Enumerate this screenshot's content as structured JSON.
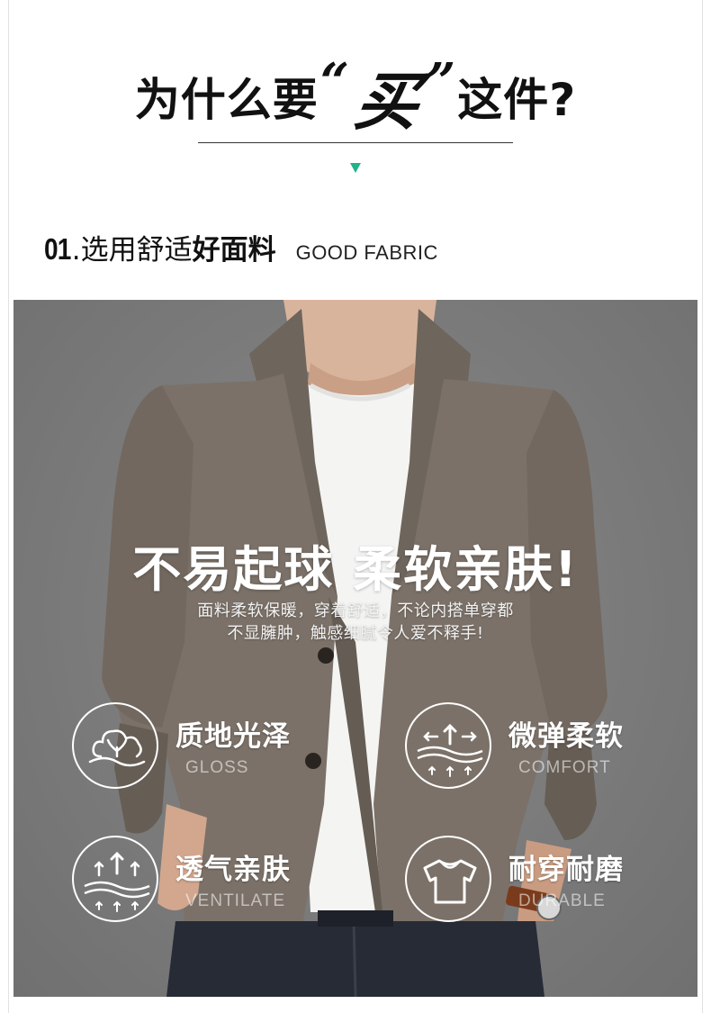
{
  "header": {
    "title_prefix": "为什么要",
    "open_quote": "“",
    "accent_word": "买",
    "close_quote": "”",
    "title_suffix": "这件?"
  },
  "section": {
    "number": "01",
    "title_light": ".选用舒适",
    "title_bold": "好面料",
    "title_en": "GOOD FABRIC"
  },
  "hero": {
    "headline": "不易起球  柔软亲肤!",
    "description_line1": "面料柔软保暖，穿着舒适，不论内搭单穿都",
    "description_line2": "不显臃肿，触感细腻令人爱不释手!"
  },
  "features": [
    {
      "label": "质地光泽",
      "en": "GLOSS",
      "icon": "cloud-sprout-icon"
    },
    {
      "label": "微弹柔软",
      "en": "COMFORT",
      "icon": "stretch-arrows-icon"
    },
    {
      "label": "透气亲肤",
      "en": "VENTILATE",
      "icon": "breathable-arrows-icon"
    },
    {
      "label": "耐穿耐磨",
      "en": "DURABLE",
      "icon": "tshirt-icon"
    }
  ],
  "colors": {
    "accent_arrow": "#1fb389",
    "background": "#ffffff",
    "photo_bg": "#7c7c7c",
    "jacket": "#7b7168",
    "text_dark": "#111111",
    "text_light": "#ffffff"
  }
}
